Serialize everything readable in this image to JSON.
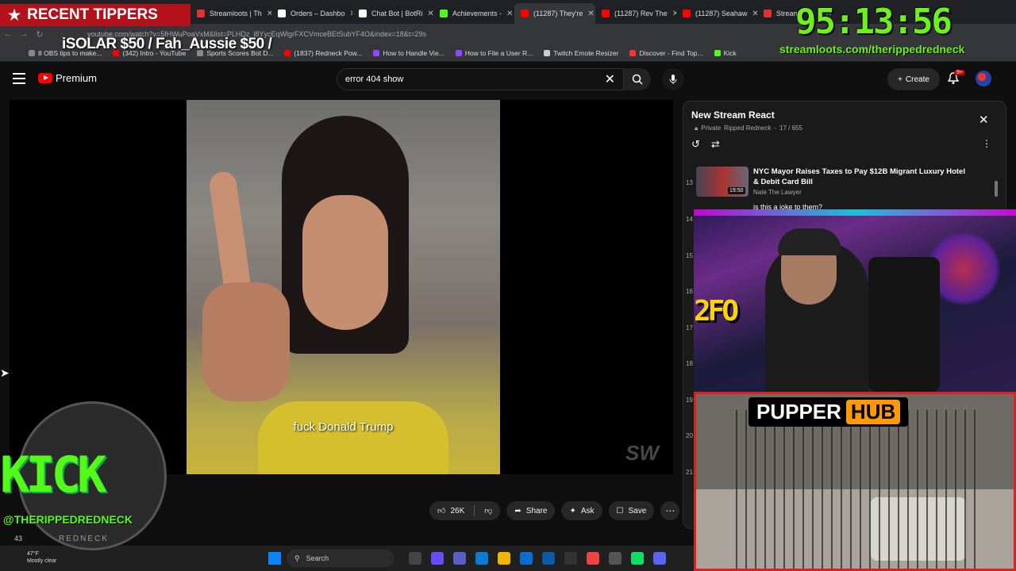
{
  "browser": {
    "tabs": [
      {
        "label": "Streamloots | Th",
        "color": "#d33",
        "active": false
      },
      {
        "label": "Orders – Dashbo",
        "color": "#fff",
        "active": false
      },
      {
        "label": "Chat Bot | BotRi",
        "color": "#fff",
        "active": false
      },
      {
        "label": "Achievements -",
        "color": "#53fc18",
        "active": false
      },
      {
        "label": "(11287) They're",
        "color": "#f00",
        "active": true
      },
      {
        "label": "(11287) Rev The",
        "color": "#f00",
        "active": false
      },
      {
        "label": "(11287) Seahaw",
        "color": "#f00",
        "active": false
      },
      {
        "label": "Stream",
        "color": "#d33",
        "active": false
      }
    ],
    "url": "youtube.com/watch?v=5fHWuPoaVxM&list=PLHDz_l8YycEqWlgrFXCVmceBEtSubYF4O&index=18&t=29s",
    "bookmarks": [
      {
        "label": "8 OBS tips to make...",
        "color": "#888"
      },
      {
        "label": "(342) Intro - YouTube",
        "color": "#f00"
      },
      {
        "label": "Sports Scores Bot D...",
        "color": "#888"
      },
      {
        "label": "(1837) Redneck Pow...",
        "color": "#f00"
      },
      {
        "label": "How to Handle Vie...",
        "color": "#9146ff"
      },
      {
        "label": "How to File a User R...",
        "color": "#9146ff"
      },
      {
        "label": "Twitch Emote Resizer",
        "color": "#ccc"
      },
      {
        "label": "Discover - Find Top...",
        "color": "#f33"
      },
      {
        "label": "Kick",
        "color": "#53fc18"
      }
    ]
  },
  "overlay": {
    "tippers_title": "RECENT TIPPERS",
    "tippers_line": "iSOLAR $50 / Fah_Aussie $50 /",
    "timer": "95:13:56",
    "loots_url": "streamloots.com/therippedredneck",
    "kick_text": "KICK",
    "kick_handle": "@THERIPPEDREDNECK",
    "kick_sub": "REDNECK",
    "left_count": "43"
  },
  "youtube": {
    "brand": "Premium",
    "search_value": "error 404 show",
    "create_label": "Create",
    "notif_badge": "9+"
  },
  "player": {
    "subtitle": "fuck Donald Trump",
    "watermark": "SW"
  },
  "actions": {
    "like_count": "26K",
    "share": "Share",
    "ask": "Ask",
    "save": "Save"
  },
  "playlist": {
    "title": "New Stream React",
    "privacy": "Private",
    "owner": "Ripped Redneck",
    "position": "17 / 655",
    "current": {
      "index": "13",
      "title": "NYC Mayor Raises Taxes to Pay $12B Migrant Luxury Hotel & Debit Card Bill",
      "channel": "Nate The Lawyer",
      "duration": "19:50"
    },
    "next_title": "is this a joke to them?",
    "other_indexes": [
      "14",
      "15",
      "16",
      "17",
      "18",
      "19",
      "20",
      "21"
    ]
  },
  "webcam": {
    "sign": "2FO"
  },
  "pupper": {
    "name": "PUPPER",
    "hub": "HUB"
  },
  "taskbar": {
    "temp": "47°F",
    "weather": "Mostly clear",
    "search": "Search"
  }
}
